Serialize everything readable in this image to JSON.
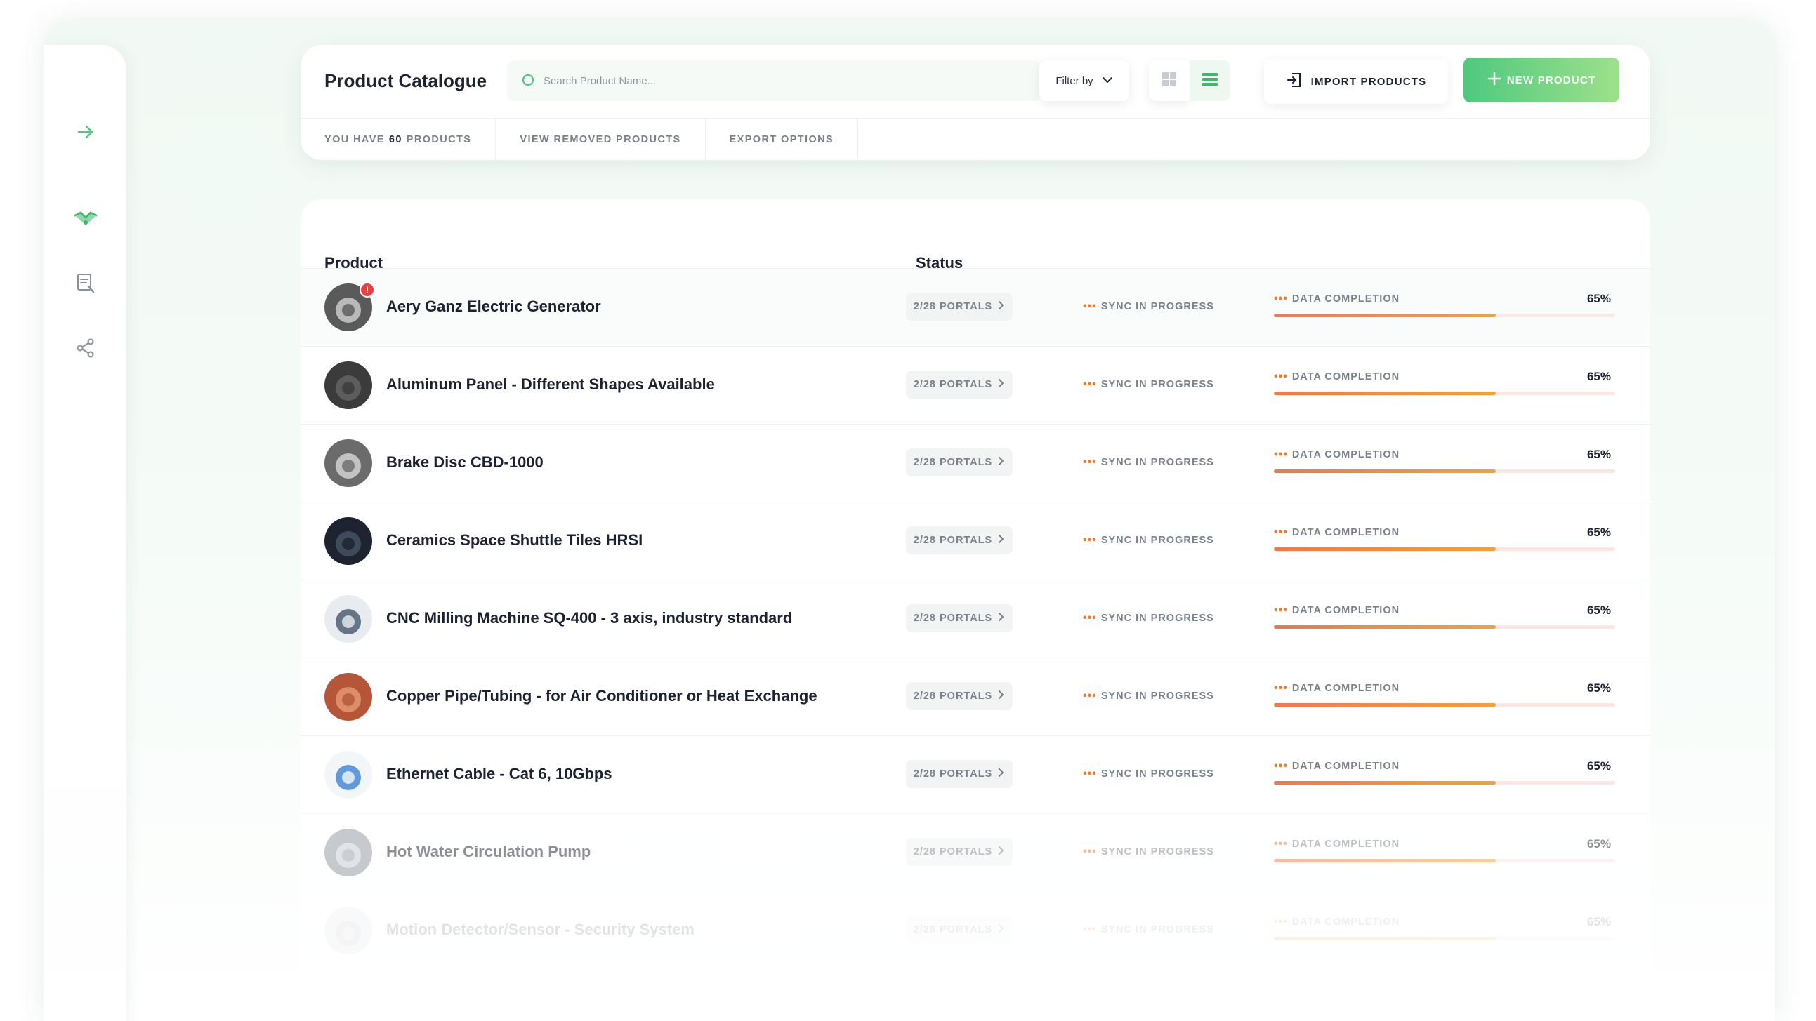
{
  "header": {
    "title": "Product Catalogue",
    "search_placeholder": "Search Product Name...",
    "filter_label": "Filter by",
    "import_label": "IMPORT PRODUCTS",
    "new_label": "NEW PRODUCT",
    "tabs": {
      "count_prefix": "YOU HAVE",
      "count_value": "60",
      "count_suffix": "PRODUCTS",
      "removed": "VIEW REMOVED PRODUCTS",
      "export": "EXPORT OPTIONS"
    }
  },
  "table": {
    "col_product": "Product",
    "col_status": "Status",
    "rows": [
      {
        "name": "Aery Ganz Electric Generator",
        "portals": "2/28 PORTALS",
        "sync": "SYNC IN PROGRESS",
        "dc_label": "DATA COMPLETION",
        "dc_pct": "65%",
        "completion": 0.65,
        "badge": "!",
        "thumb_color": "#5a5a5a",
        "thumb_accent": "#d9d9d9"
      },
      {
        "name": "Aluminum Panel - Different Shapes Available",
        "portals": "2/28 PORTALS",
        "sync": "SYNC IN PROGRESS",
        "dc_label": "DATA COMPLETION",
        "dc_pct": "65%",
        "completion": 0.65,
        "thumb_color": "#3b3b3b",
        "thumb_accent": "#6a6a6a"
      },
      {
        "name": "Brake Disc CBD-1000",
        "portals": "2/28 PORTALS",
        "sync": "SYNC IN PROGRESS",
        "dc_label": "DATA COMPLETION",
        "dc_pct": "65%",
        "completion": 0.65,
        "thumb_color": "#6b6b6b",
        "thumb_accent": "#e0e0e0"
      },
      {
        "name": "Ceramics Space Shuttle Tiles HRSI",
        "portals": "2/28 PORTALS",
        "sync": "SYNC IN PROGRESS",
        "dc_label": "DATA COMPLETION",
        "dc_pct": "65%",
        "completion": 0.65,
        "thumb_color": "#1e2330",
        "thumb_accent": "#4a5a6a"
      },
      {
        "name": "CNC Milling Machine SQ-400 - 3 axis, industry standard",
        "portals": "2/28 PORTALS",
        "sync": "SYNC IN PROGRESS",
        "dc_label": "DATA COMPLETION",
        "dc_pct": "65%",
        "completion": 0.65,
        "thumb_color": "#e8ecf0",
        "thumb_accent": "#3b4c66"
      },
      {
        "name": "Copper Pipe/Tubing - for Air Conditioner or Heat Exchange",
        "portals": "2/28 PORTALS",
        "sync": "SYNC IN PROGRESS",
        "dc_label": "DATA COMPLETION",
        "dc_pct": "65%",
        "completion": 0.65,
        "thumb_color": "#b5563a",
        "thumb_accent": "#e9a07a"
      },
      {
        "name": "Ethernet Cable - Cat 6, 10Gbps",
        "portals": "2/28 PORTALS",
        "sync": "SYNC IN PROGRESS",
        "dc_label": "DATA COMPLETION",
        "dc_pct": "65%",
        "completion": 0.65,
        "thumb_color": "#f3f6f9",
        "thumb_accent": "#2f7bd0"
      },
      {
        "name": "Hot Water Circulation Pump",
        "portals": "2/28 PORTALS",
        "sync": "SYNC IN PROGRESS",
        "dc_label": "DATA COMPLETION",
        "dc_pct": "65%",
        "completion": 0.65,
        "thumb_color": "#8f959c",
        "thumb_accent": "#d7dbe0"
      },
      {
        "name": "Motion Detector/Sensor - Security System",
        "portals": "2/28 PORTALS",
        "sync": "SYNC IN PROGRESS",
        "dc_label": "DATA COMPLETION",
        "dc_pct": "65%",
        "completion": 0.65,
        "thumb_color": "#cfd4d9",
        "thumb_accent": "#9aa1a8"
      }
    ]
  },
  "colors": {
    "accent_green": "#4fc97e",
    "progress_orange": "#ee7a4c",
    "badge_red": "#ee3d3d"
  }
}
